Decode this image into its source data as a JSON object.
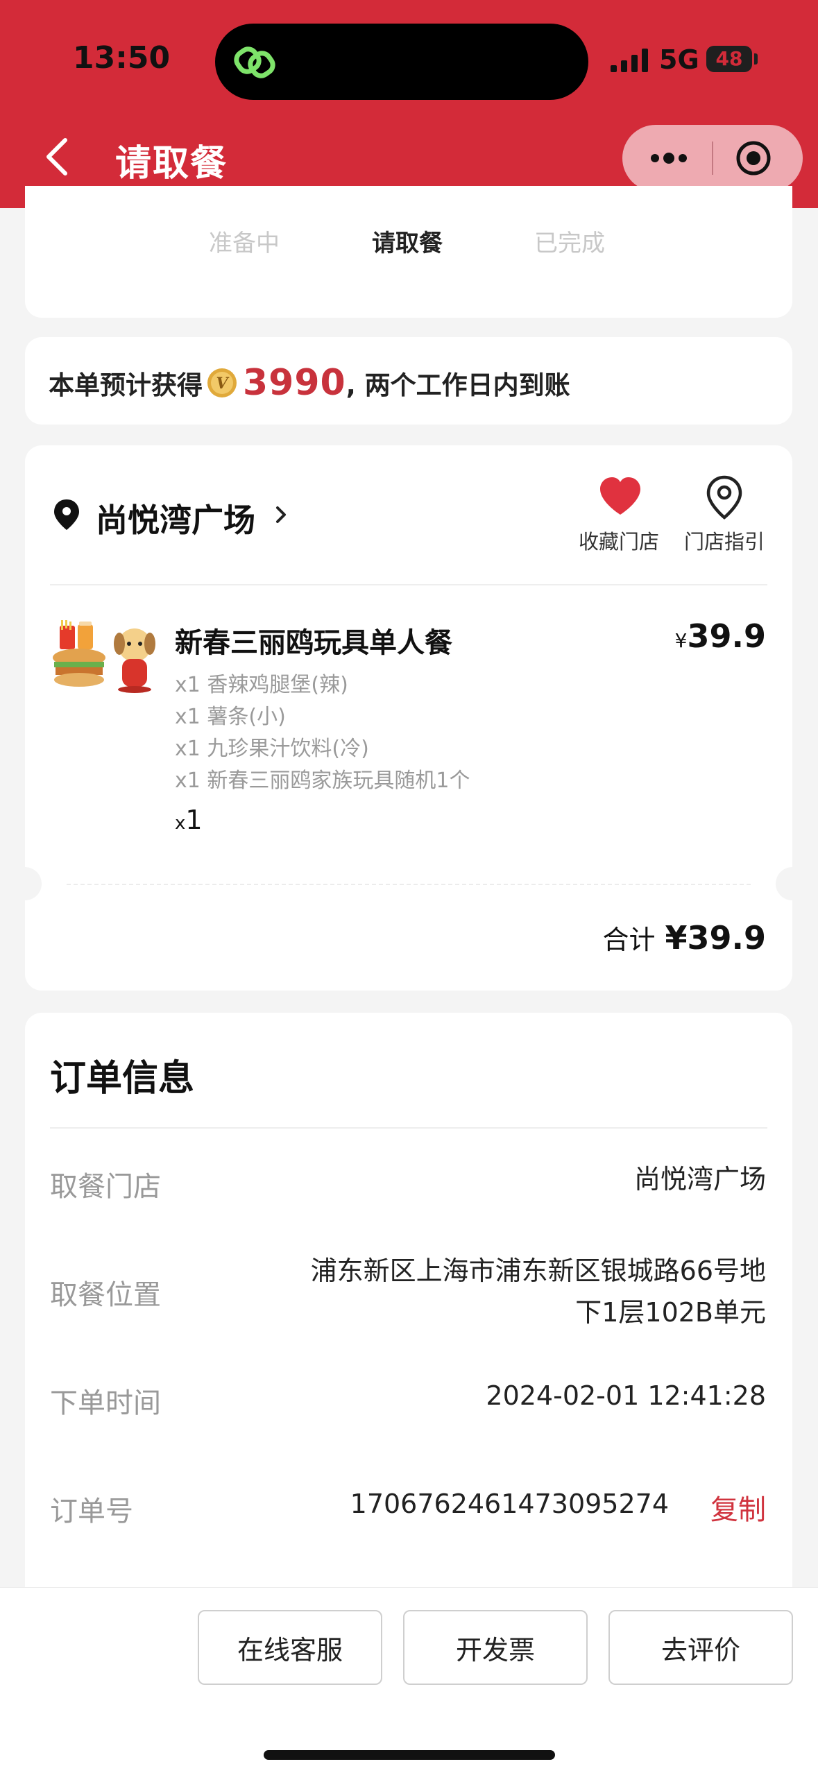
{
  "status_bar": {
    "time": "13:50",
    "network": "5G",
    "battery": "48"
  },
  "nav": {
    "title": "请取餐"
  },
  "progress": {
    "steps": [
      "准备中",
      "请取餐",
      "已完成"
    ],
    "active_index": 1
  },
  "points": {
    "prefix": "本单预计获得",
    "coin_letter": "V",
    "amount": "3990",
    "suffix": ", 两个工作日内到账"
  },
  "store": {
    "name": "尚悦湾广场",
    "favorite_label": "收藏门店",
    "guide_label": "门店指引"
  },
  "order_item": {
    "name": "新春三丽鸥玩具单人餐",
    "currency": "¥",
    "price": "39.9",
    "sub_items": [
      "x1 香辣鸡腿堡(辣)",
      "x1 薯条(小)",
      "x1 九珍果汁饮料(冷)",
      "x1 新春三丽鸥家族玩具随机1个"
    ],
    "qty_prefix": "x",
    "qty": "1"
  },
  "total": {
    "label": "合计",
    "value": "¥39.9"
  },
  "order_info": {
    "title": "订单信息",
    "rows": [
      {
        "label": "取餐门店",
        "value": "尚悦湾广场"
      },
      {
        "label": "取餐位置",
        "value_line1": "浦东新区上海市浦东新区银城路66号地",
        "value_line2": "下1层102B单元"
      },
      {
        "label": "下单时间",
        "value": "2024-02-01 12:41:28"
      },
      {
        "label": "订单号",
        "value": "1706762461473095274",
        "action": "复制"
      }
    ]
  },
  "buttons": {
    "service": "在线客服",
    "invoice": "开发票",
    "review": "去评价"
  },
  "colors": {
    "brand_red": "#d32b39",
    "price_red": "#c8323c",
    "copy_red": "#d0333e"
  }
}
